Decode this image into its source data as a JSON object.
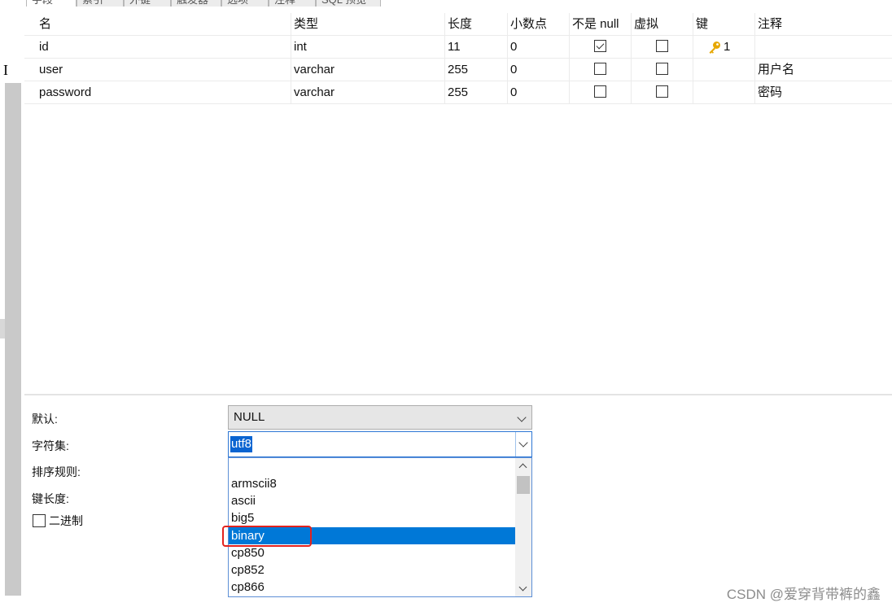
{
  "tabs": [
    "字段",
    "索引",
    "外键",
    "触发器",
    "选项",
    "注释",
    "SQL 预览"
  ],
  "grid": {
    "columns": [
      "名",
      "类型",
      "长度",
      "小数点",
      "不是 null",
      "虚拟",
      "键",
      "注释"
    ],
    "rows": [
      {
        "name": "id",
        "type": "int",
        "length": "11",
        "decimals": "0",
        "not_null": true,
        "virtual": false,
        "key": "1",
        "comment": ""
      },
      {
        "name": "user",
        "type": "varchar",
        "length": "255",
        "decimals": "0",
        "not_null": false,
        "virtual": false,
        "key": "",
        "comment": "用户名"
      },
      {
        "name": "password",
        "type": "varchar",
        "length": "255",
        "decimals": "0",
        "not_null": false,
        "virtual": false,
        "key": "",
        "comment": "密码"
      }
    ]
  },
  "panel": {
    "default_label": "默认:",
    "default_value": "NULL",
    "charset_label": "字符集:",
    "charset_value": "utf8",
    "collation_label": "排序规则:",
    "key_length_label": "键长度:",
    "binary_label": "二进制",
    "charset_options": [
      "",
      "armscii8",
      "ascii",
      "big5",
      "binary",
      "cp850",
      "cp852",
      "cp866"
    ],
    "selected_option": "binary"
  },
  "watermark": "CSDN @爱穿背带裤的鑫",
  "colors": {
    "selection": "#0078d7",
    "highlight_box": "#e3231e",
    "key_icon": "#e6a700"
  }
}
